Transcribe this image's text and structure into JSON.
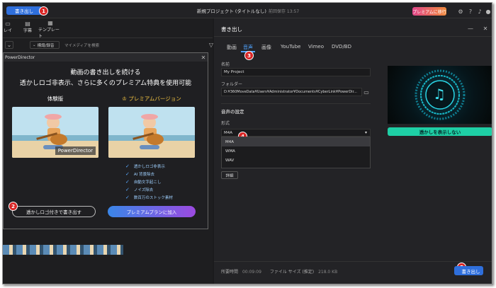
{
  "topbar": {
    "export_label": "書き出し",
    "project_title": "新規プロジェクト (タイトルなし)",
    "saved_time": "前回保存 13:57",
    "premium_label": "プレミアムに移行"
  },
  "badges": {
    "b1": "1",
    "b2": "2",
    "b3": "3",
    "b4": "4",
    "b5": "5"
  },
  "toolbar": {
    "item1": "レイ",
    "item2": "字幕",
    "item3": "テンプレート"
  },
  "media": {
    "filter_label": "標識/録音",
    "search_placeholder": "マイメディアを検索"
  },
  "dialog": {
    "app_name": "PowerDirector",
    "heading1": "動画の書き出しを続ける",
    "heading2": "透かしロゴ非表示、さらに多くのプレミアム特典を使用可能",
    "trial_label": "体験版",
    "premium_version_label": "プレミアムバージョン",
    "watermark_text": "PowerDirector",
    "features": [
      "透かしロゴ非表示",
      "AI 背景除去",
      "自動文字起こし",
      "ノイズ除去",
      "数百万のストック素材"
    ],
    "export_with_watermark": "透かしロゴ付きで書き出す",
    "join_premium": "プレミアムプランに加入"
  },
  "export_panel": {
    "title": "書き出し",
    "tabs": [
      "動画",
      "音声",
      "画像",
      "YouTube",
      "Vimeo",
      "DVD/BD"
    ],
    "active_tab": "音声",
    "name_label": "名前",
    "name_value": "My Project",
    "folder_label": "フォルダー",
    "folder_value": "D:¥360MoveData¥Users¥Administrator¥Documents¥CyberLink¥PowerDir...",
    "audio_settings_label": "音声の設定",
    "format_label": "形式",
    "format_selected": "M4A",
    "format_options": [
      "M4A",
      "WMA",
      "WAV"
    ],
    "detail_button": "詳細",
    "hide_watermark_button": "透かしを表示しない",
    "duration_label": "所要時間",
    "duration_value": "00:09:09",
    "filesize_label": "ファイル サイズ (推定)",
    "filesize_value": "218.0 KB",
    "export_button": "書き出し"
  },
  "colors": {
    "accent": "#2f6fdc",
    "tab_active": "#4fa3ff",
    "teal": "#1ecfa5",
    "badge": "#d92626"
  },
  "icons": [
    "gear-icon",
    "help-icon",
    "bell-icon",
    "user-icon",
    "minimize-icon",
    "close-icon",
    "folder-icon",
    "music-note-icon",
    "check-icon",
    "crown-icon"
  ]
}
